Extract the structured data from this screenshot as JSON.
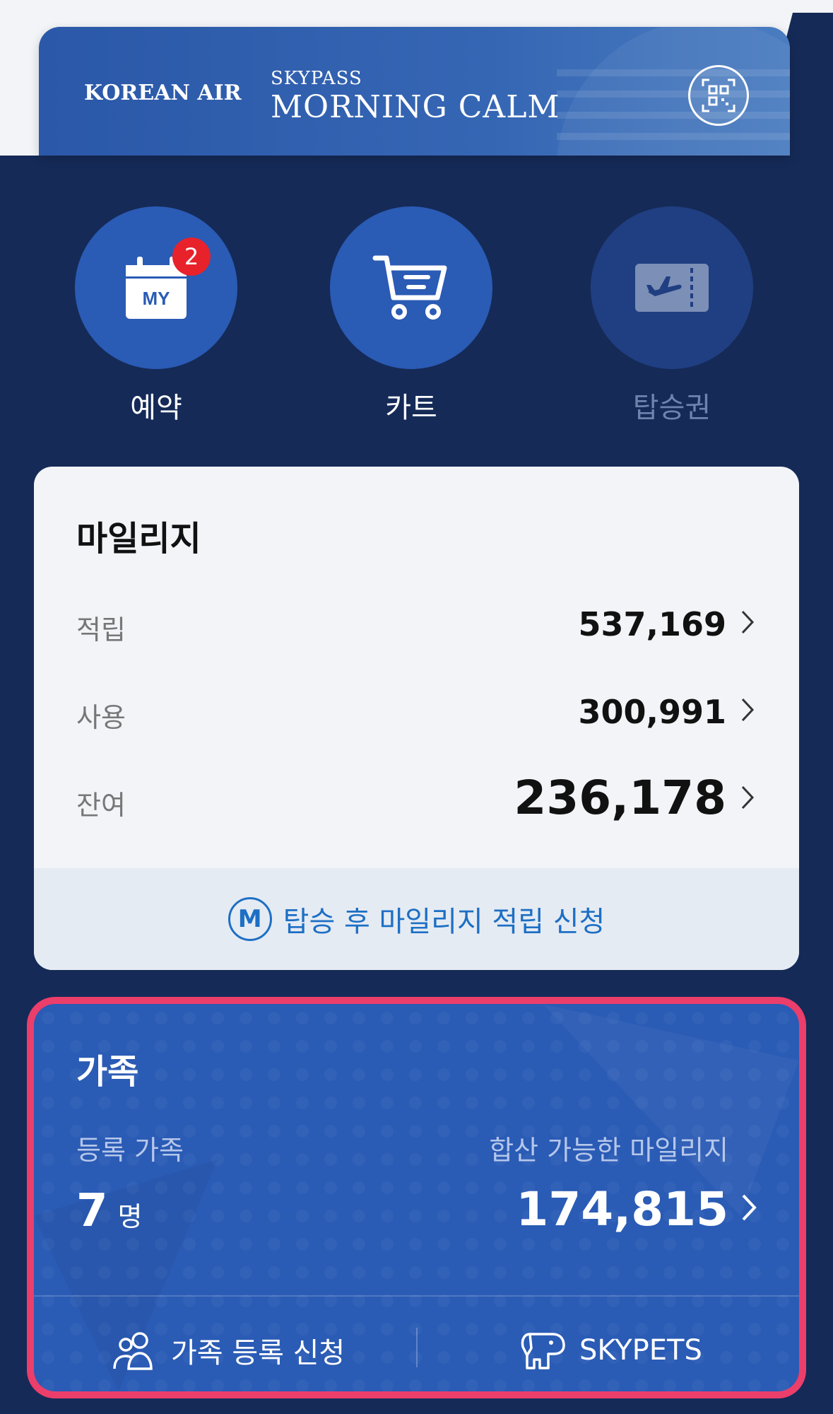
{
  "member_card": {
    "airline_logo": "KOREAN AIR",
    "program_small": "SKYPASS",
    "program_tier": "MORNING CALM",
    "qr_icon": "qr-code-icon"
  },
  "quick_actions": [
    {
      "label": "예약",
      "icon": "calendar-my-icon",
      "icon_text": "MY",
      "badge": "2"
    },
    {
      "label": "카트",
      "icon": "cart-icon"
    },
    {
      "label": "탑승권",
      "icon": "boarding-pass-icon",
      "disabled": true
    }
  ],
  "mileage": {
    "title": "마일리지",
    "rows": [
      {
        "label": "적립",
        "value": "537,169"
      },
      {
        "label": "사용",
        "value": "300,991"
      },
      {
        "label": "잔여",
        "value": "236,178"
      }
    ],
    "footer_icon_letter": "M",
    "footer_link": "탑승 후 마일리지 적립 신청"
  },
  "family": {
    "title": "가족",
    "registered_label": "등록 가족",
    "registered_count": "7",
    "registered_unit": "명",
    "combinable_label": "합산 가능한 마일리지",
    "combinable_value": "174,815",
    "actions": [
      {
        "label": "가족 등록 신청",
        "icon": "family-users-icon"
      },
      {
        "label": "SKYPETS",
        "icon": "dog-icon"
      }
    ]
  },
  "colors": {
    "background_navy": "#152a57",
    "brand_blue": "#2a5bb5",
    "link_blue": "#1d6fc4",
    "badge_red": "#e8222b",
    "highlight_pink": "#ec3e6b"
  }
}
